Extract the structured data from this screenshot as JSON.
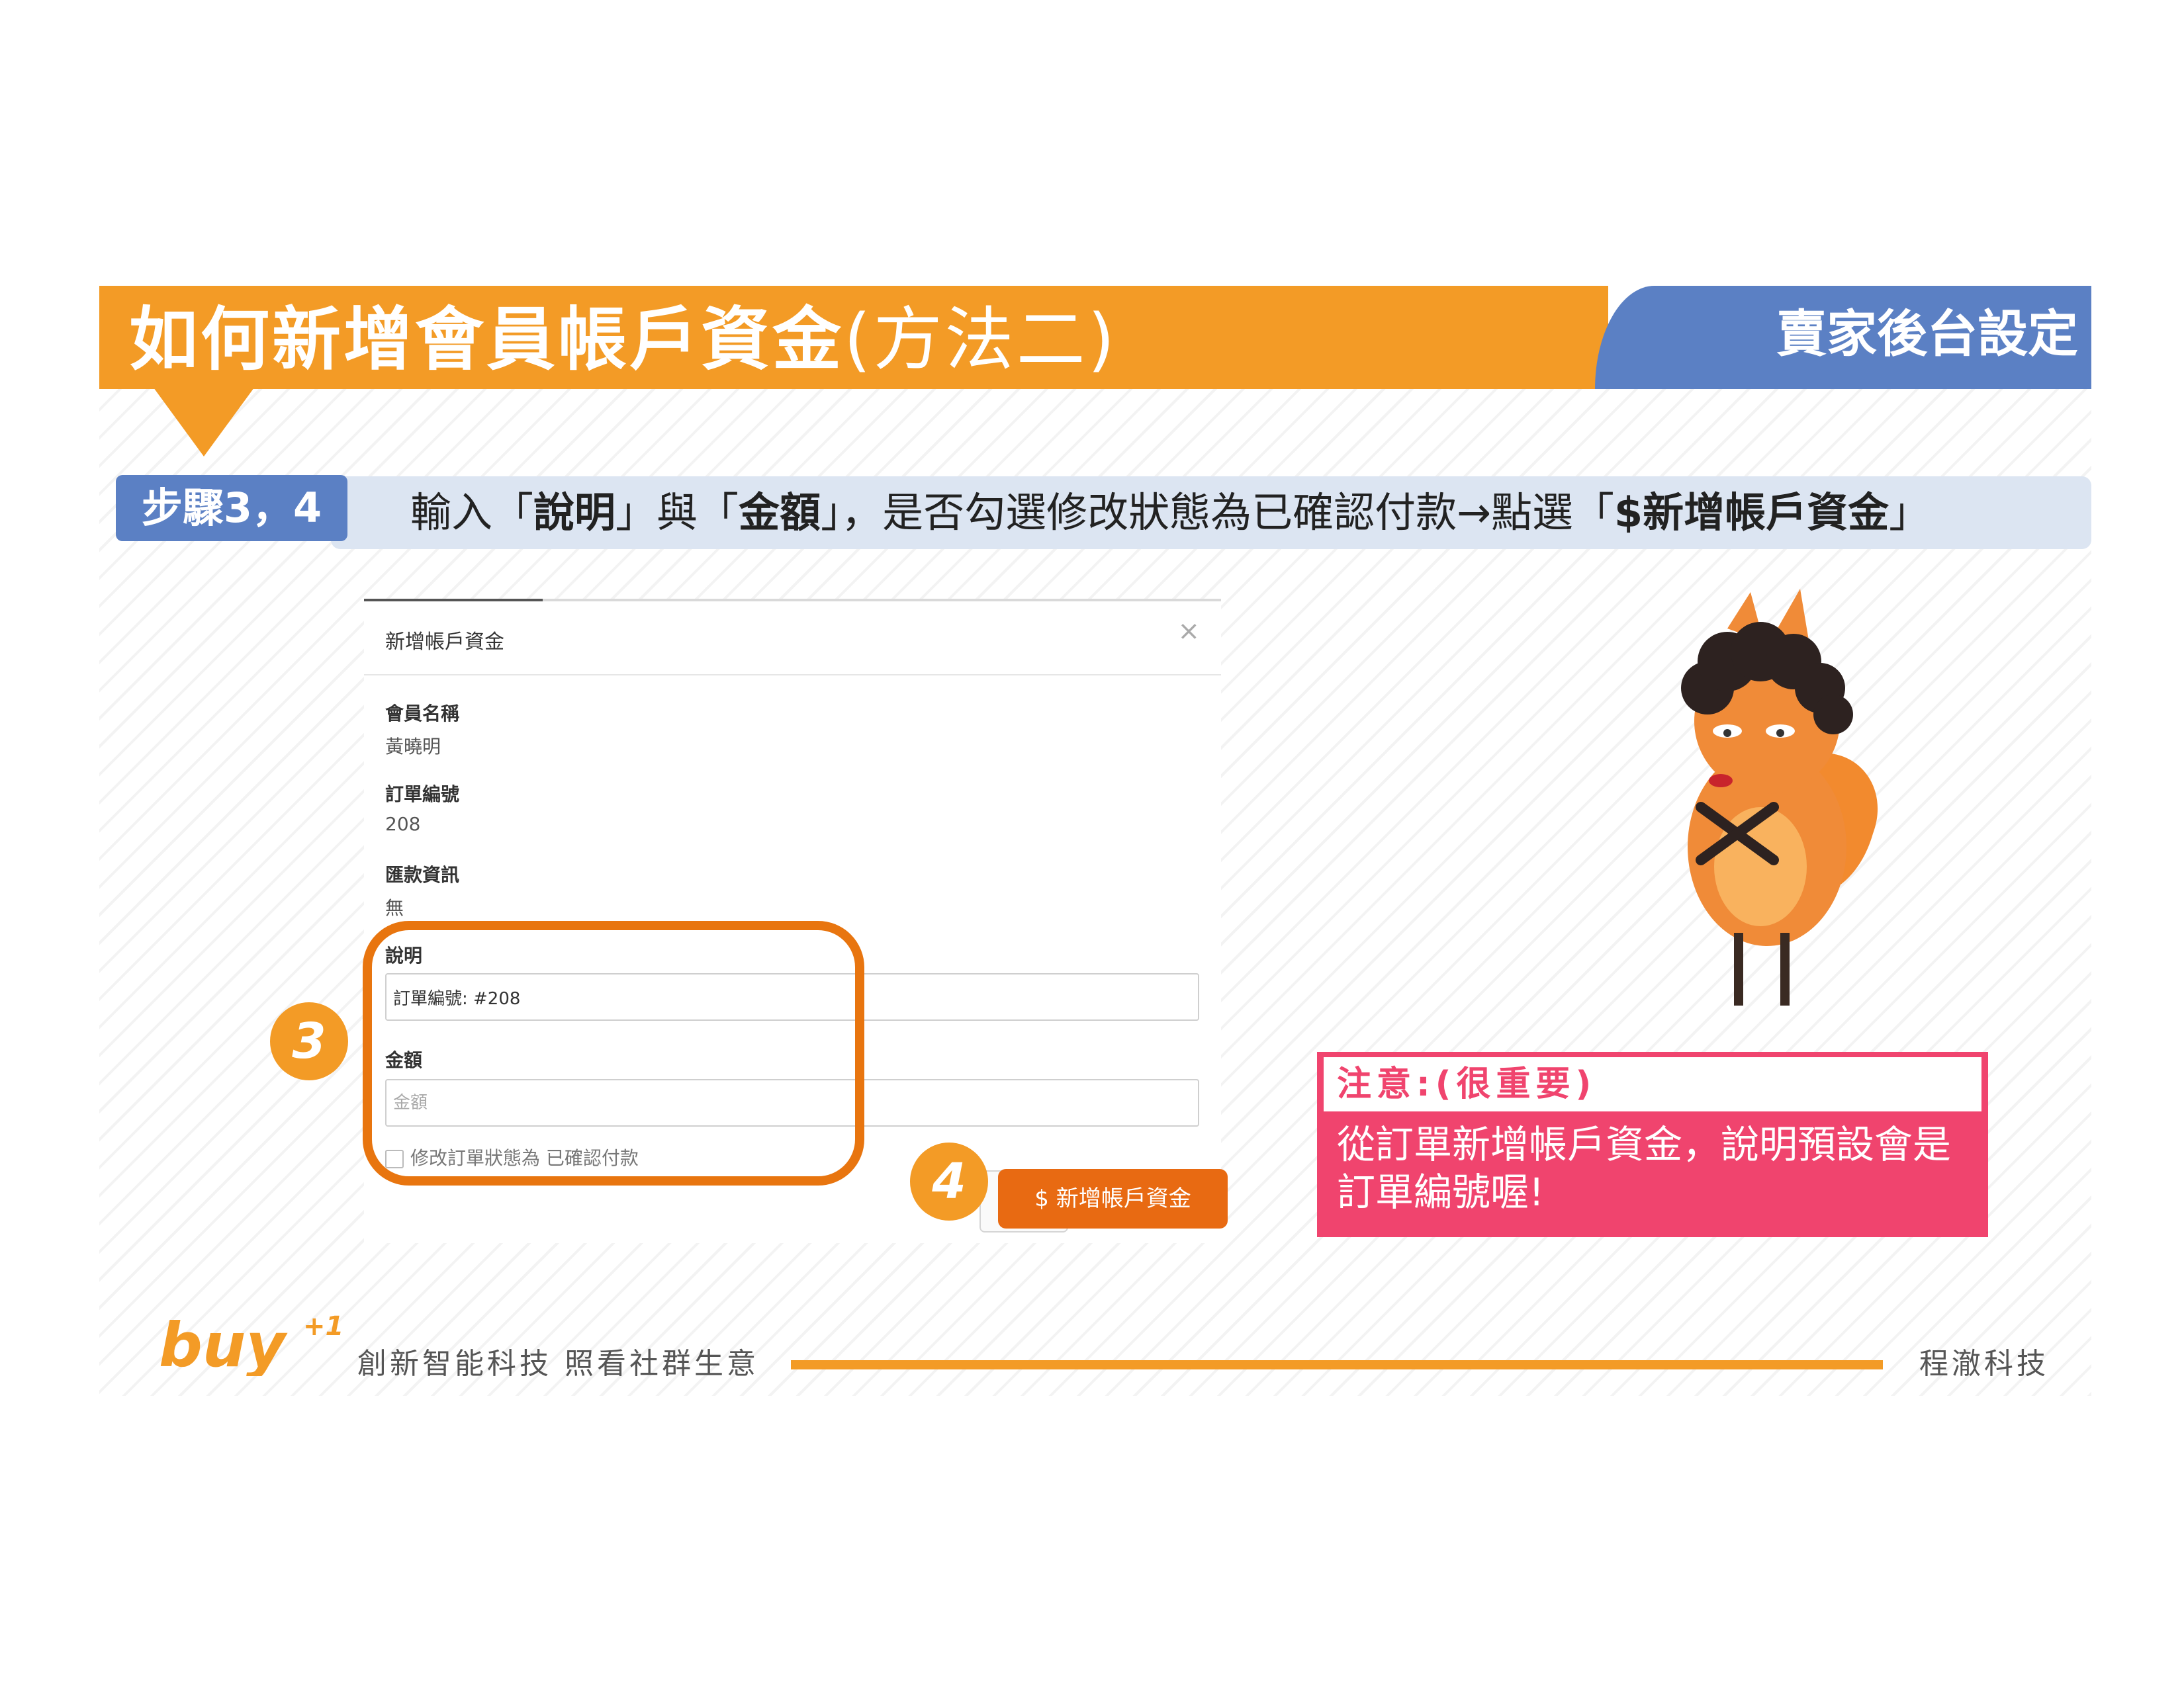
{
  "header": {
    "title_bold": "如何新增會員帳戶資金",
    "title_normal": "(方法二)",
    "category": "賣家後台設定"
  },
  "step": {
    "badge": "步驟3，4",
    "text_1": "輸入「",
    "bold_1": "說明",
    "text_2": "」與「",
    "bold_2": "金額",
    "text_3": "」，是否勾選修改狀態為已確認付款→點選「",
    "bold_3": "$新增帳戶資金",
    "text_4": "」"
  },
  "modal": {
    "title": "新增帳戶資金",
    "close": "×",
    "member_name_label": "會員名稱",
    "member_name_value": "黃曉明",
    "order_no_label": "訂單編號",
    "order_no_value": "208",
    "remit_label": "匯款資訊",
    "remit_value": "無",
    "desc_label": "說明",
    "desc_value": "訂單編號: #208",
    "amount_label": "金額",
    "amount_placeholder": "金額",
    "checkbox_label": "修改訂單狀態為 已確認付款",
    "submit_label": "$ 新增帳戶資金"
  },
  "callouts": {
    "step3": "3",
    "step4": "4"
  },
  "note": {
    "heading": "注意:(很重要)",
    "body": "從訂單新增帳戶資金，說明預設會是訂單編號喔!"
  },
  "footer": {
    "logo_text": "buy",
    "logo_sup": "+1",
    "slogan": "創新智能科技 照看社群生意",
    "company": "程澈科技"
  },
  "colors": {
    "orange": "#F39B26",
    "blue": "#5B80C4",
    "pink": "#F0446E",
    "highlight": "#E8750F"
  }
}
